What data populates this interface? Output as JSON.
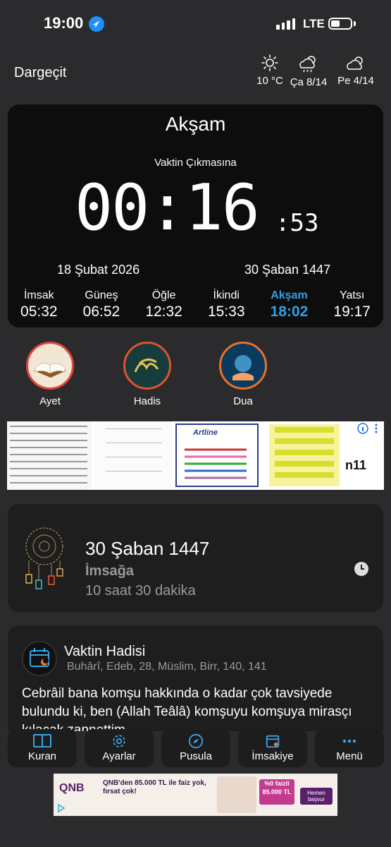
{
  "status": {
    "time": "19:00",
    "network": "LTE"
  },
  "header": {
    "city": "Dargeçit",
    "weather": [
      {
        "icon": "sun-icon",
        "label": "10 °C"
      },
      {
        "icon": "rain-cloud-icon",
        "label": "Ça 8/14"
      },
      {
        "icon": "partly-cloudy-icon",
        "label": "Pe 4/14"
      }
    ]
  },
  "main": {
    "prayer_name": "Akşam",
    "remaining_label": "Vaktin Çıkmasına",
    "countdown": "00:16",
    "seconds": ":53",
    "date_gregorian": "18 Şubat 2026",
    "date_hijri": "30 Şaban 1447",
    "times": [
      {
        "name": "İmsak",
        "time": "05:32"
      },
      {
        "name": "Güneş",
        "time": "06:52"
      },
      {
        "name": "Öğle",
        "time": "12:32"
      },
      {
        "name": "İkindi",
        "time": "15:33"
      },
      {
        "name": "Akşam",
        "time": "18:02"
      },
      {
        "name": "Yatsı",
        "time": "19:17"
      }
    ],
    "active_color": "#2f9fe6"
  },
  "shortcuts": [
    {
      "label": "Ayet"
    },
    {
      "label": "Hadis"
    },
    {
      "label": "Dua"
    }
  ],
  "ad_banner": {
    "brand1": "Artline",
    "brand2": "n11"
  },
  "hijri_card": {
    "date": "30 Şaban 1447",
    "target": "İmsağa",
    "remaining": "10 saat 30 dakika"
  },
  "hadith": {
    "title": "Vaktin Hadisi",
    "source": "Buhârî, Edeb, 28, Müslim, Birr, 140, 141",
    "text": "Cebrâil bana komşu hakkında o kadar çok tavsiyede bulundu ki, ben (Allah Teâlâ) komşuyu komşuya mirasçı kılacak zannettim."
  },
  "nav": [
    {
      "label": "Kuran",
      "icon": "book-icon"
    },
    {
      "label": "Ayarlar",
      "icon": "gear-icon"
    },
    {
      "label": "Pusula",
      "icon": "compass-icon"
    },
    {
      "label": "İmsakiye",
      "icon": "calendar-icon"
    },
    {
      "label": "Menü",
      "icon": "more-icon"
    }
  ],
  "bottom_ad": {
    "brand": "QNB",
    "headline": "QNB'den 85.000 TL ile faiz yok, fırsat çok!",
    "rate": "%0 faizli 85.000 TL",
    "cta": "Hemen başvur"
  }
}
